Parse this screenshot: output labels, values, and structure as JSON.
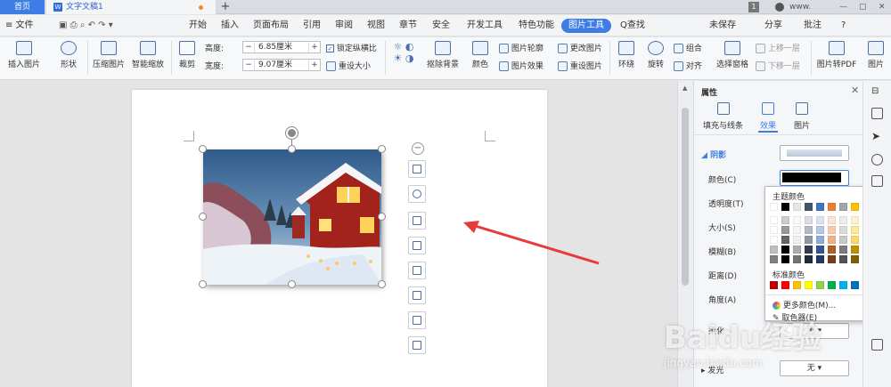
{
  "tabs": {
    "home": "首页",
    "doc": "文字文稿1",
    "page_num": "1",
    "user": "www."
  },
  "menus": [
    "≡ 文件",
    "开始",
    "插入",
    "页面布局",
    "引用",
    "审阅",
    "视图",
    "章节",
    "安全",
    "开发工具",
    "特色功能",
    "图片工具",
    "Q查找"
  ],
  "menu_right": [
    "未保存",
    "分享",
    "批注",
    "?"
  ],
  "ribbon": {
    "insert_pic": "插入图片",
    "shape": "形状",
    "compress": "压缩图片",
    "smart_zoom": "智能缩放",
    "crop": "裁剪",
    "height_label": "高度:",
    "height_value": "6.85厘米",
    "width_label": "宽度:",
    "width_value": "9.07厘米",
    "lock_ratio": "锁定纵横比",
    "reset_size": "重设大小",
    "remove_bg": "抠除背景",
    "color": "颜色",
    "pic_outline": "图片轮廓",
    "pic_effect": "图片效果",
    "change_pic": "更改图片",
    "reset_pic": "重设图片",
    "wrap": "环绕",
    "rotate": "旋转",
    "group": "组合",
    "align": "对齐",
    "select_pane": "选择窗格",
    "up_one": "上移一层",
    "down_one": "下移一层",
    "pic_to_pdf": "图片转PDF",
    "pic_more": "图片"
  },
  "panel": {
    "title": "属性",
    "tabs": [
      "填充与线条",
      "效果",
      "图片"
    ],
    "section": "阴影",
    "labels": [
      "颜色(C)",
      "透明度(T)",
      "大小(S)",
      "模糊(B)",
      "距离(D)",
      "角度(A)",
      "柔化",
      "发光"
    ],
    "none_value": "无"
  },
  "colorpop": {
    "theme": "主题颜色",
    "standard": "标准颜色",
    "more": "更多颜色(M)...",
    "picker": "取色器(E)"
  },
  "colors": {
    "accent": "#3d7de4",
    "theme_top": [
      "#ffffff",
      "#000000",
      "#e7e6e6",
      "#44546a",
      "#4472c4",
      "#ed7d31",
      "#a5a5a5",
      "#ffc000",
      "#5b9bd5",
      "#70ad47"
    ],
    "standard": [
      "#c00000",
      "#ff0000",
      "#ffc000",
      "#ffff00",
      "#92d050",
      "#00b050",
      "#00b0f0",
      "#0070c0",
      "#002060",
      "#7030a0"
    ],
    "shadow_color": "#000000"
  },
  "watermark": "Baidu经验",
  "watermark_sub": "jingyan.baidu.com"
}
